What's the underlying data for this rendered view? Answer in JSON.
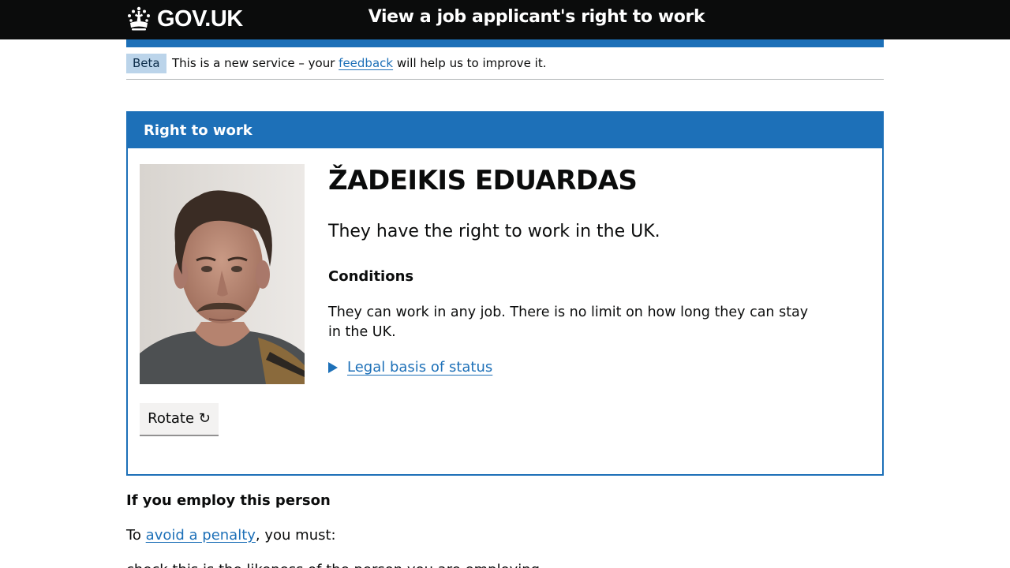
{
  "header": {
    "logo_text": "GOV.UK",
    "service_name": "View a job applicant's right to work"
  },
  "phase_banner": {
    "tag": "Beta",
    "text_before": "This is a new service – your ",
    "link": "feedback",
    "text_after": " will help us to improve it."
  },
  "card": {
    "title": "Right to work",
    "name": "ŽADEIKIS EDUARDAS",
    "status": "They have the right to work in the UK.",
    "conditions_heading": "Conditions",
    "conditions_text": "They can work in any job. There is no limit on how long they can stay in the UK.",
    "details_link": "Legal basis of status",
    "rotate_label": "Rotate ↻"
  },
  "employ": {
    "heading": "If you employ this person",
    "text_before": "To ",
    "link": "avoid a penalty",
    "text_after": ", you must:",
    "cut_off_line": "check this is the likeness of the person you are employing"
  },
  "colors": {
    "header_bg": "#0b0c0c",
    "brand_blue": "#1d70b8",
    "tag_bg": "#bbd4ea",
    "button_bg": "#f3f2f1"
  }
}
